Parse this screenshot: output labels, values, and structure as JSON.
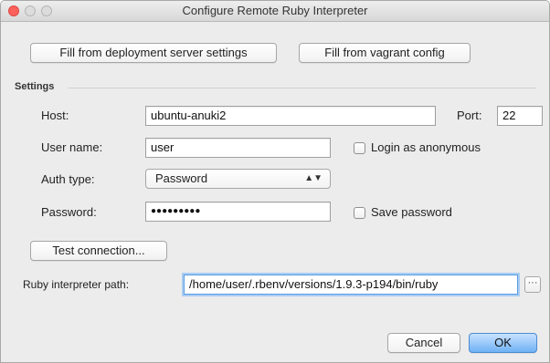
{
  "window": {
    "title": "Configure Remote Ruby Interpreter"
  },
  "buttons": {
    "fill_deployment": "Fill from deployment server settings",
    "fill_vagrant": "Fill from vagrant config",
    "test_connection": "Test connection...",
    "browse": "···",
    "cancel": "Cancel",
    "ok": "OK"
  },
  "settings": {
    "section_label": "Settings",
    "host_label": "Host:",
    "host_value": "ubuntu-anuki2",
    "port_label": "Port:",
    "port_value": "22",
    "username_label": "User name:",
    "username_value": "user",
    "login_anonymous_label": "Login as anonymous",
    "login_anonymous_checked": false,
    "auth_type_label": "Auth type:",
    "auth_type_value": "Password",
    "password_label": "Password:",
    "password_value": "●●●●●●●●●",
    "save_password_label": "Save password",
    "save_password_checked": false
  },
  "interpreter": {
    "label": "Ruby interpreter path:",
    "value": "/home/user/.rbenv/versions/1.9.3-p194/bin/ruby"
  },
  "colors": {
    "close_button": "#fc605b",
    "primary_button": "#6fb1f5",
    "focus_ring": "#a9cdf3"
  }
}
